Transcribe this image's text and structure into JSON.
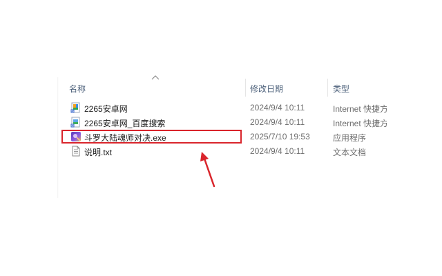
{
  "columns": {
    "name": "名称",
    "date": "修改日期",
    "type": "类型"
  },
  "files": [
    {
      "name": "2265安卓网",
      "date": "2024/9/4 10:11",
      "type": "Internet 快捷方式",
      "icon": "internet-shortcut-icon"
    },
    {
      "name": "2265安卓网_百度搜索",
      "date": "2024/9/4 10:11",
      "type": "Internet 快捷方式",
      "icon": "internet-shortcut-icon"
    },
    {
      "name": "斗罗大陆魂师对决.exe",
      "date": "2025/7/10 19:53",
      "type": "应用程序",
      "icon": "game-app-icon"
    },
    {
      "name": "说明.txt",
      "date": "2024/9/4 10:11",
      "type": "文本文档",
      "icon": "text-file-icon"
    }
  ],
  "colors": {
    "highlight": "#d9242b",
    "arrow": "#d9242b",
    "header_text": "#4c607a"
  }
}
